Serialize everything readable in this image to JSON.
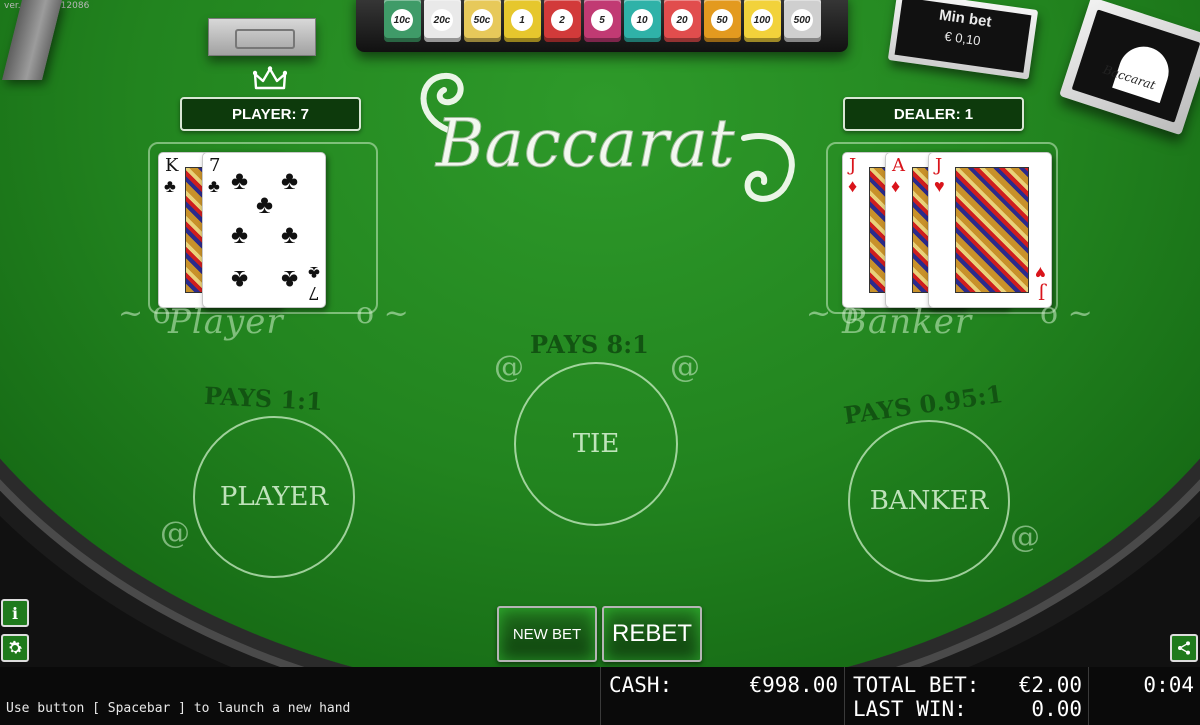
{
  "version": "ver. 2.5.614.12086",
  "chip_tray": {
    "chips": [
      {
        "label": "10c",
        "color": "#3f9b68"
      },
      {
        "label": "20c",
        "color": "#e9e9e9"
      },
      {
        "label": "50c",
        "color": "#e7c95a"
      },
      {
        "label": "1",
        "color": "#e6c72d"
      },
      {
        "label": "2",
        "color": "#d23a3a"
      },
      {
        "label": "5",
        "color": "#c13a73"
      },
      {
        "label": "10",
        "color": "#2fb2a8"
      },
      {
        "label": "20",
        "color": "#e14d4d"
      },
      {
        "label": "50",
        "color": "#e39a1f"
      },
      {
        "label": "100",
        "color": "#f2d23b"
      },
      {
        "label": "500",
        "color": "#cfcfcf"
      }
    ]
  },
  "min_bet": {
    "title": "Min bet",
    "value": "€ 0,10"
  },
  "card_box_brand": "Baccarat",
  "scores": {
    "player": "PLAYER: 7",
    "dealer": "DEALER: 1"
  },
  "logo_text": "Baccarat",
  "hands": {
    "player": [
      {
        "rank": "K",
        "suit": "♣",
        "color": "black"
      },
      {
        "rank": "7",
        "suit": "♣",
        "color": "black"
      }
    ],
    "banker": [
      {
        "rank": "J",
        "suit": "♦",
        "color": "red"
      },
      {
        "rank": "A",
        "suit": "♦",
        "color": "red"
      },
      {
        "rank": "J",
        "suit": "♥",
        "color": "red"
      }
    ]
  },
  "area_labels": {
    "player": "Player",
    "banker": "Banker"
  },
  "bets": {
    "player": {
      "pays": "PAYS 1:1",
      "label": "PLAYER"
    },
    "tie": {
      "pays": "PAYS 8:1",
      "label": "TIE"
    },
    "banker": {
      "pays": "PAYS 0.95:1",
      "label": "BANKER"
    }
  },
  "buttons": {
    "new_bet": "NEW BET",
    "rebet": "REBET"
  },
  "icons": {
    "info": "i",
    "settings": "gear-icon",
    "share": "share-icon"
  },
  "status_bar": {
    "hint": "Use button [ Spacebar ] to launch a new hand",
    "cash_label": "CASH:",
    "cash_value": "€998.00",
    "total_bet_label": "TOTAL BET:",
    "total_bet_value": "€2.00",
    "last_win_label": "LAST WIN:",
    "last_win_value": "0.00",
    "timer": "0:04"
  },
  "colors": {
    "felt": "#22841f",
    "button_glow": "#3cdc3c",
    "card_red": "#d9141b"
  }
}
